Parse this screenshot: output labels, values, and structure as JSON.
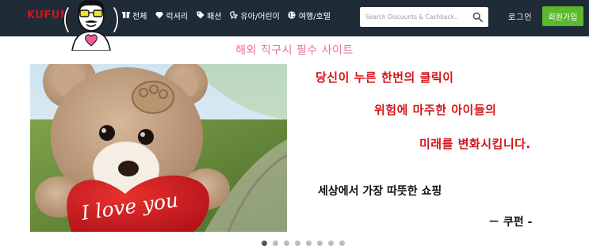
{
  "header": {
    "logo_text": "KUFUN",
    "nav": [
      {
        "icon": "box-icon",
        "label": "전체"
      },
      {
        "icon": "diamond-icon",
        "label": "럭셔리"
      },
      {
        "icon": "tag-icon",
        "label": "패션"
      },
      {
        "icon": "stroller-icon",
        "label": "유아/어린이"
      },
      {
        "icon": "globe-icon",
        "label": "여행/호텔"
      }
    ],
    "search_placeholder": "Search Discounts & Cashback..",
    "login_label": "로그인",
    "signup_label": "회원가입"
  },
  "slider": {
    "subtitle": "해외 직구시 필수 사이트",
    "image_caption": "I love you",
    "lines": [
      "당신이 누른 한번의 클릭이",
      "위험에 마주한 아이들의",
      "미래를 변화시킵니다."
    ],
    "tagline": "세상에서 가장 따뜻한 쇼핑",
    "signature": "－ 쿠펀 -",
    "dot_count": 8,
    "active_dot": 1
  },
  "colors": {
    "header_bg": "#1f2c37",
    "accent_green": "#5cb82f",
    "subtitle_pink": "#ef6f92",
    "message_red": "#d5141a"
  }
}
